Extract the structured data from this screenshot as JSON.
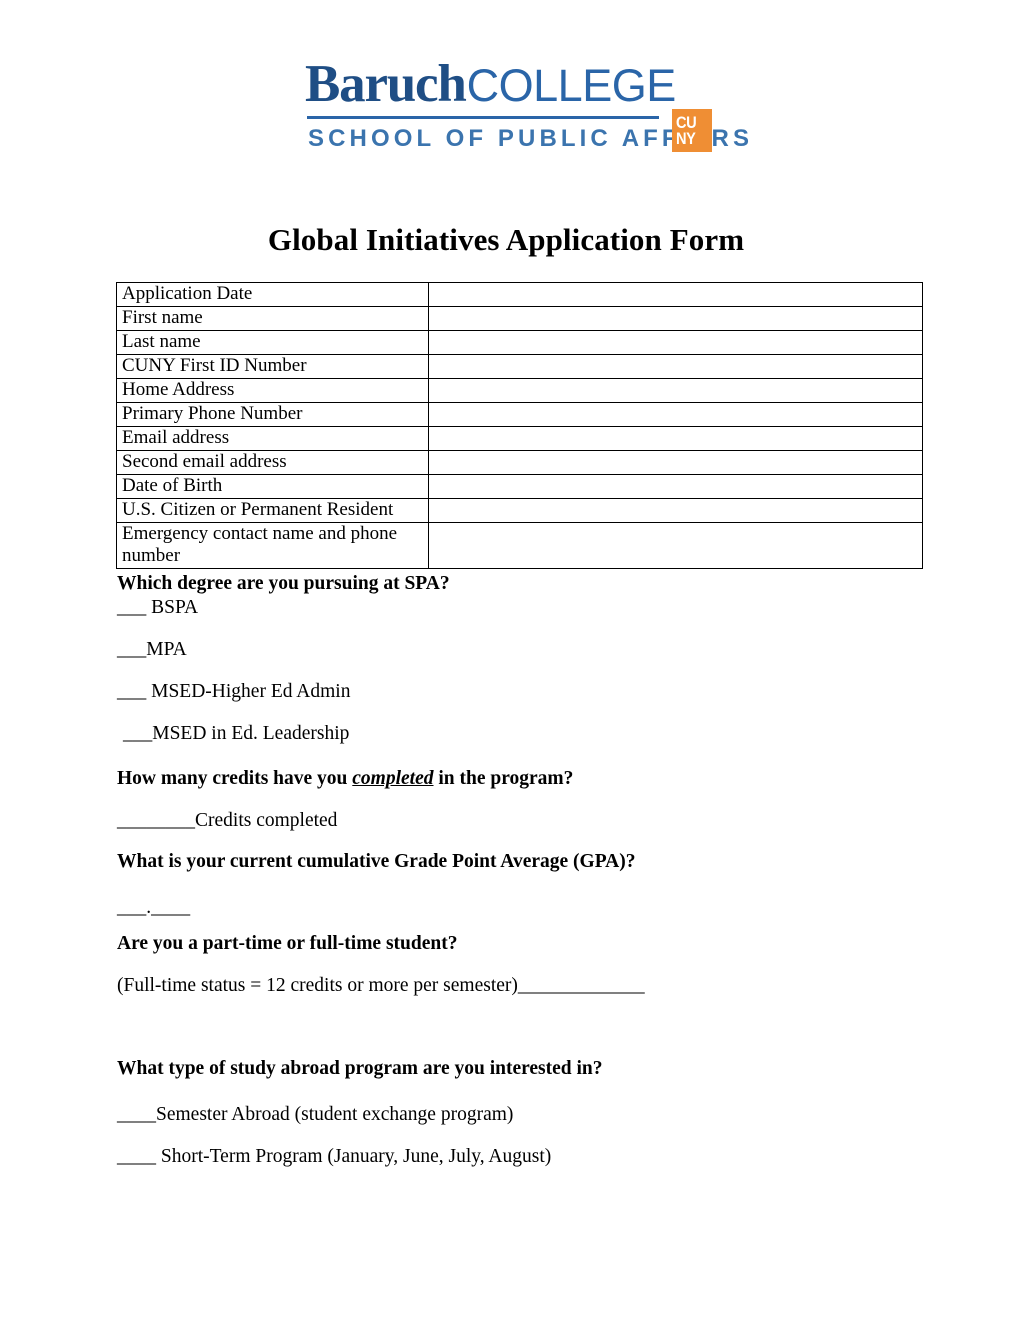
{
  "logo": {
    "baruch": "Baruch",
    "college": "COLLEGE",
    "school": "SCHOOL OF PUBLIC AFFAIRS",
    "cuny_line1": "CU",
    "cuny_line2": "NY",
    "blue": "#1F4E85",
    "light_blue": "#3B74AE",
    "orange": "#EF8E34"
  },
  "title": "Global Initiatives Application Form",
  "table": {
    "rows": [
      {
        "label": "Application Date",
        "value": ""
      },
      {
        "label": "First name",
        "value": ""
      },
      {
        "label": "Last name",
        "value": ""
      },
      {
        "label": "CUNY First ID Number",
        "value": ""
      },
      {
        "label": "Home Address",
        "value": ""
      },
      {
        "label": "Primary Phone Number",
        "value": ""
      },
      {
        "label": "Email address",
        "value": ""
      },
      {
        "label": "Second email address",
        "value": ""
      },
      {
        "label": "Date of Birth",
        "value": ""
      },
      {
        "label": "U.S. Citizen or Permanent Resident",
        "value": ""
      },
      {
        "label": "Emergency contact name and phone number",
        "value": ""
      }
    ]
  },
  "questions": {
    "degree": {
      "heading": "Which degree are you pursuing at SPA?",
      "options": [
        "___ BSPA",
        "___MPA",
        "___ MSED-Higher Ed Admin",
        "___MSED in Ed. Leadership"
      ]
    },
    "credits": {
      "heading_pre": "How many credits have you ",
      "heading_emph": "completed",
      "heading_post": " in the program?",
      "answer": "________Credits completed"
    },
    "gpa": {
      "heading": "What is your current cumulative Grade Point Average (GPA)?",
      "answer": "___.____"
    },
    "status": {
      "heading": "Are you a part-time or full-time student?",
      "answer": "(Full-time status = 12 credits or more per semester)_____________"
    },
    "program_type": {
      "heading": "What type of study abroad program are you interested in?",
      "options": [
        "____Semester Abroad (student exchange program)",
        "____ Short-Term Program (January, June, July, August)"
      ]
    }
  }
}
